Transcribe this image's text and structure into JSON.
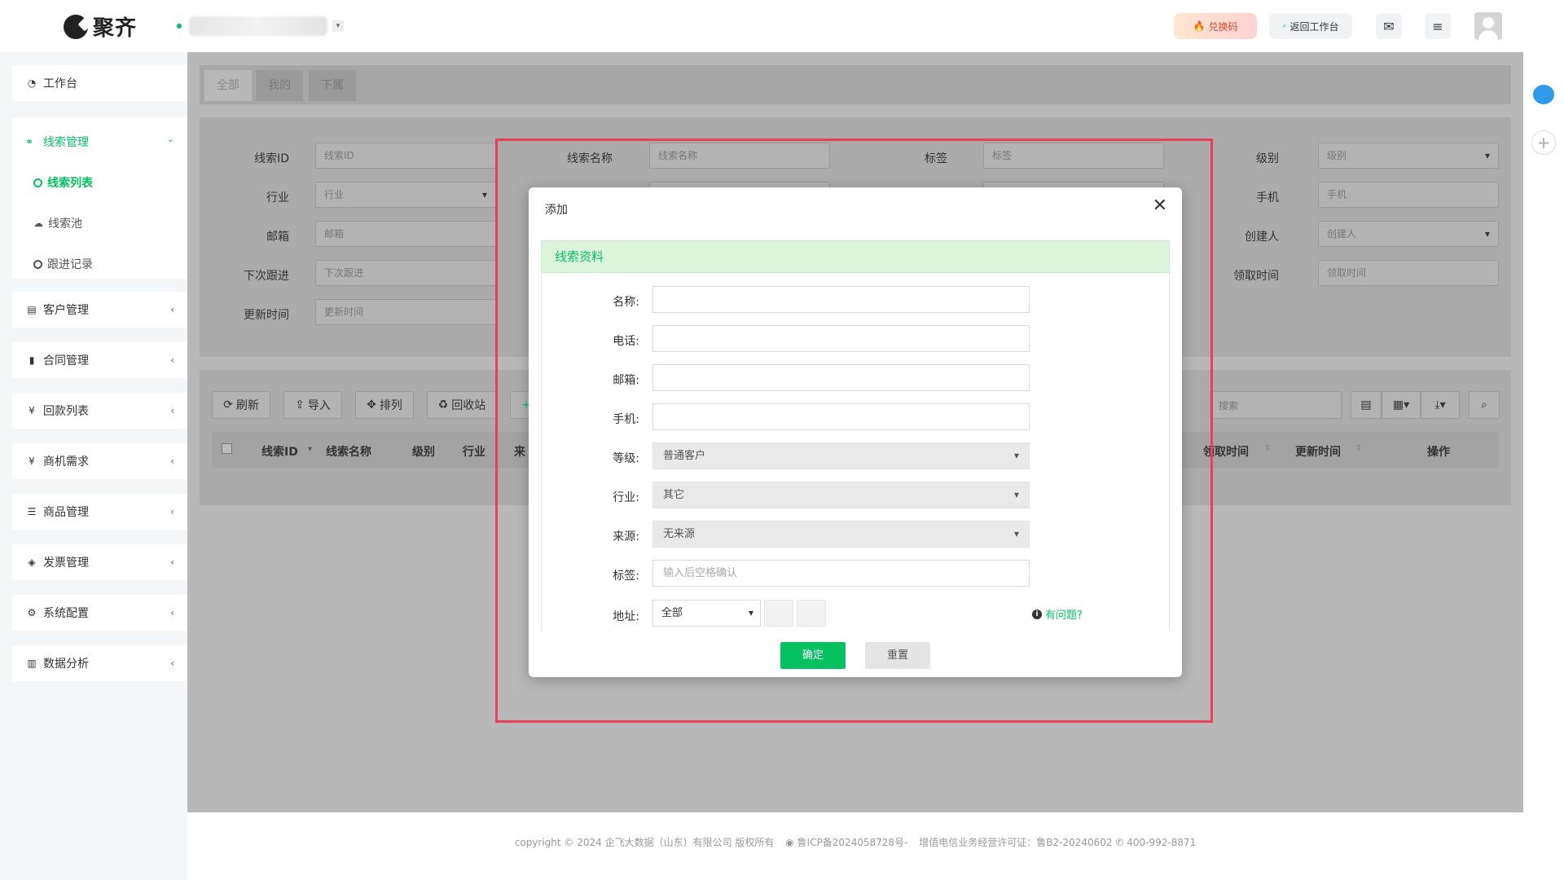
{
  "header": {
    "logo_text": "聚齐",
    "redeem_label": "兑换码",
    "workbench_label": "返回工作台",
    "icons": [
      "mail-icon",
      "menu-icon",
      "avatar"
    ]
  },
  "sidebar": {
    "workbench": "工作台",
    "lead_group": {
      "label": "线索管理",
      "items": [
        "线索列表",
        "线索池",
        "跟进记录"
      ]
    },
    "items": [
      "客户管理",
      "合同管理",
      "回款列表",
      "商机需求",
      "商品管理",
      "发票管理",
      "系统配置",
      "数据分析"
    ]
  },
  "tabs": [
    "全部",
    "我的",
    "下属"
  ],
  "filters": {
    "labels": [
      "线索ID",
      "行业",
      "邮箱",
      "下次跟进",
      "更新时间",
      "线索名称",
      "标签",
      "级别",
      "手机",
      "创建人",
      "领取时间"
    ],
    "placeholders": {
      "lead_id": "线索ID",
      "industry": "行业",
      "email": "邮箱",
      "next_follow": "下次跟进",
      "update_time": "更新时间",
      "lead_name": "线索名称",
      "tag": "标签",
      "level": "级别",
      "phone": "手机",
      "creator": "创建人",
      "claim_time": "领取时间"
    }
  },
  "toolbar": {
    "refresh": "刷新",
    "import": "导入",
    "sort": "排列",
    "recycle": "回收站",
    "search_placeholder": "搜索"
  },
  "table": {
    "headers": [
      "线索ID",
      "线索名称",
      "级别",
      "行业",
      "来",
      "领取时间",
      "更新时间",
      "操作"
    ]
  },
  "footer": {
    "text": "copyright © 2024 企飞大数据（山东）有限公司 版权所有",
    "icp": "鲁ICP备2024058728号-",
    "license": "增值电信业务经营许可证：鲁B2-20240602",
    "phone": "400-992-8871"
  },
  "modal": {
    "title": "添加",
    "section": "线索资料",
    "fields": {
      "name": "名称:",
      "tel": "电话:",
      "email": "邮箱:",
      "mobile": "手机:",
      "grade": "等级:",
      "industry": "行业:",
      "source": "来源:",
      "tag": "标签:",
      "address": "地址:"
    },
    "grade_value": "普通客户",
    "industry_value": "其它",
    "source_value": "无来源",
    "tag_placeholder": "输入后空格确认",
    "address_value": "全部",
    "help": "有问题?",
    "ok": "确定",
    "reset": "重置"
  },
  "colors": {
    "brand": "#07c160",
    "highlight": "#e8405a"
  }
}
